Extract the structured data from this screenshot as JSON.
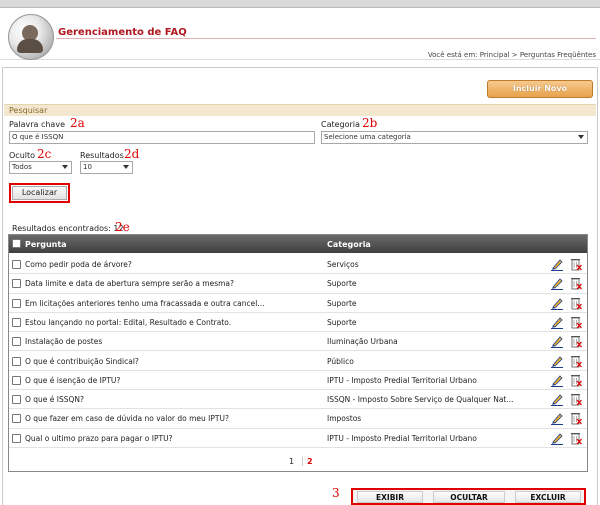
{
  "header": {
    "title": "Gerenciamento de FAQ",
    "breadcrumb": "Você está em: Principal > Perguntas Freqüêntes"
  },
  "toolbar": {
    "incluir_label": "Incluir Novo"
  },
  "search": {
    "section_title": "Pesquisar",
    "keyword_label": "Palavra chave",
    "keyword_value": "O que é ISSQN",
    "category_label": "Categoria",
    "category_value": "Selecione uma categoria",
    "hidden_label": "Oculto",
    "hidden_value": "Todos",
    "results_label": "Resultados",
    "results_value": "10",
    "submit_label": "Localizar"
  },
  "annotations": {
    "a": "2a",
    "b": "2b",
    "c": "2c",
    "d": "2d",
    "e": "2e",
    "actions": "3"
  },
  "results": {
    "label": "Resultados encontrados:",
    "count": "12"
  },
  "table": {
    "columns": [
      "Pergunta",
      "Categoria"
    ],
    "rows": [
      {
        "q": "Como pedir poda de árvore?",
        "c": "Serviços"
      },
      {
        "q": "Data limite e data de abertura sempre serão a mesma?",
        "c": "Suporte"
      },
      {
        "q": "Em licitações anteriores tenho uma fracassada e outra cancel...",
        "c": "Suporte"
      },
      {
        "q": "Estou lançando no portal: Edital, Resultado e Contrato.",
        "c": "Suporte"
      },
      {
        "q": "Instalação de postes",
        "c": "Iluminação Urbana"
      },
      {
        "q": "O que é contribuição Sindical?",
        "c": "Público"
      },
      {
        "q": "O que é isenção de IPTU?",
        "c": "IPTU - Imposto Predial Territorial Urbano"
      },
      {
        "q": "O que é ISSQN?",
        "c": "ISSQN - Imposto Sobre Serviço de Qualquer Nat..."
      },
      {
        "q": "O que fazer em caso de dúvida no valor do meu IPTU?",
        "c": "Impostos"
      },
      {
        "q": "Qual o ultimo prazo para pagar o IPTU?",
        "c": "IPTU - Imposto Predial Territorial Urbano"
      }
    ]
  },
  "pager": {
    "pages": [
      "1",
      "2"
    ]
  },
  "actions": {
    "exibir": "EXIBIR",
    "ocultar": "OCULTAR",
    "excluir": "EXCLUIR"
  },
  "colors": {
    "brand_red": "#b0171f",
    "annotation_red": "#e00000",
    "accent_orange": "#e7a24c"
  }
}
